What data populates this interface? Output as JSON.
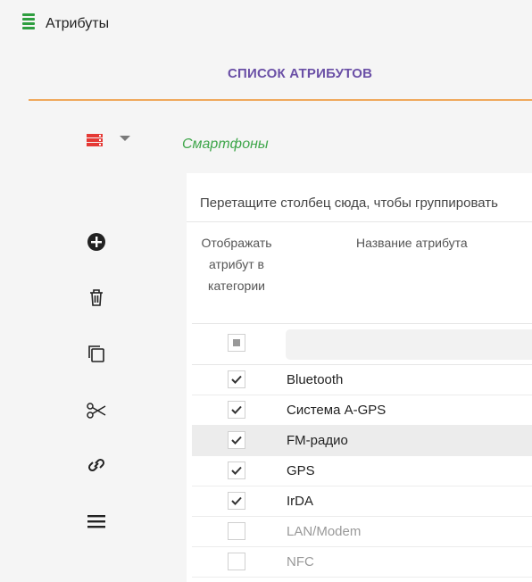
{
  "window": {
    "title": "Атрибуты",
    "icon": "list-icon"
  },
  "tab": {
    "label": "СПИСОК АТРИБУТОВ"
  },
  "category": {
    "name": "Смартфоны",
    "icon": "database-icon"
  },
  "toolbar": [
    "add-circle-icon",
    "trash-icon",
    "copy-icon",
    "scissors-icon",
    "link-icon",
    "menu-icon"
  ],
  "grid": {
    "group_hint": "Перетащите столбец сюда, чтобы группировать",
    "columns": {
      "display": "Отображать атрибут в категории",
      "name": "Название атрибута"
    },
    "rows": [
      {
        "name": "Bluetooth",
        "checked": true
      },
      {
        "name": "Система A-GPS",
        "checked": true
      },
      {
        "name": "FM-радио",
        "checked": true
      },
      {
        "name": "GPS",
        "checked": true
      },
      {
        "name": "IrDA",
        "checked": true
      },
      {
        "name": "LAN/Modem",
        "checked": false
      },
      {
        "name": "NFC",
        "checked": false
      }
    ]
  },
  "colors": {
    "accent": "#6a4fa6",
    "underline": "#f0a85c",
    "category": "#3ea64a",
    "icon_red": "#e53935",
    "icon_green": "#2e9e3f"
  }
}
